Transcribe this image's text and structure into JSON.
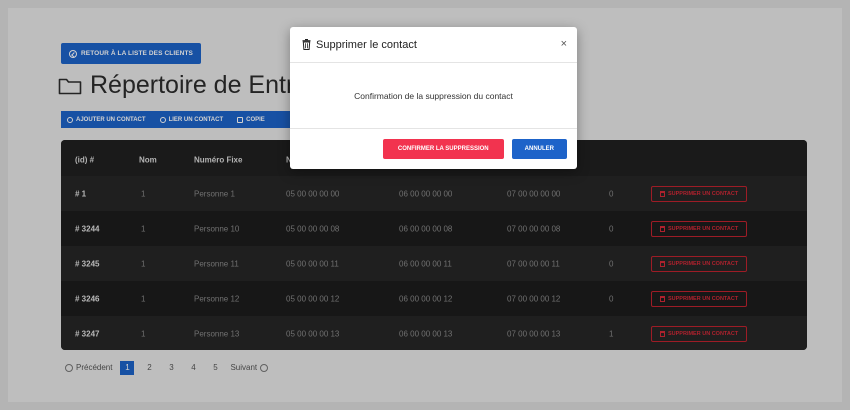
{
  "back_button": {
    "label": "RETOUR À LA LISTE DES CLIENTS",
    "icon": "arrow-left-circle-icon"
  },
  "page_title": "Répertoire de Entre",
  "actions": [
    {
      "label": "AJOUTER UN CONTACT",
      "icon": "add-user-icon"
    },
    {
      "label": "LIER UN CONTACT",
      "icon": "link-user-icon"
    },
    {
      "label": "COPIE",
      "icon": "copy-icon"
    }
  ],
  "table": {
    "headers": [
      "(id) #",
      "Nom",
      "Numéro Fixe",
      "N"
    ],
    "rows": [
      {
        "id": "# 1",
        "nom": "1",
        "contact": "Personne 1",
        "fixe": "05 00 00 00 00",
        "mobile": "06 00 00 00 00",
        "autre": "07 00 00 00 00",
        "count": "0",
        "action": "SUPPRIMER UN CONTACT"
      },
      {
        "id": "# 3244",
        "nom": "1",
        "contact": "Personne 10",
        "fixe": "05 00 00 00 08",
        "mobile": "06 00 00 00 08",
        "autre": "07 00 00 00 08",
        "count": "0",
        "action": "SUPPRIMER UN CONTACT"
      },
      {
        "id": "# 3245",
        "nom": "1",
        "contact": "Personne 11",
        "fixe": "05 00 00 00 11",
        "mobile": "06 00 00 00 11",
        "autre": "07 00 00 00 11",
        "count": "0",
        "action": "SUPPRIMER UN CONTACT"
      },
      {
        "id": "# 3246",
        "nom": "1",
        "contact": "Personne 12",
        "fixe": "05 00 00 00 12",
        "mobile": "06 00 00 00 12",
        "autre": "07 00 00 00 12",
        "count": "0",
        "action": "SUPPRIMER UN CONTACT"
      },
      {
        "id": "# 3247",
        "nom": "1",
        "contact": "Personne 13",
        "fixe": "05 00 00 00 13",
        "mobile": "06 00 00 00 13",
        "autre": "07 00 00 00 13",
        "count": "1",
        "action": "SUPPRIMER UN CONTACT"
      }
    ]
  },
  "pagination": {
    "prev": "Précédent",
    "pages": [
      "1",
      "2",
      "3",
      "4",
      "5"
    ],
    "active": "1",
    "next": "Suivant"
  },
  "modal": {
    "title": "Supprimer le contact",
    "close": "×",
    "message": "Confirmation de la suppression du contact",
    "confirm_label": "CONFIRMER LA SUPPRESSION",
    "cancel_label": "ANNULER"
  },
  "colors": {
    "primary": "#1d63c9",
    "danger": "#f2334f",
    "table_bg": "#1f1f1f"
  }
}
